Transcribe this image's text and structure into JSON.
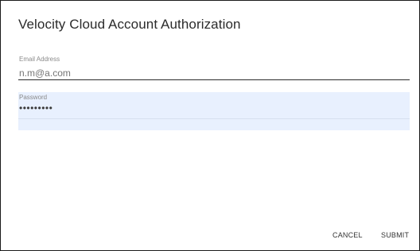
{
  "dialog": {
    "title": "Velocity Cloud Account Authorization"
  },
  "email": {
    "label": "Email Address",
    "value": "n.m@a.com"
  },
  "password": {
    "label": "Password",
    "value": "•••••••••"
  },
  "actions": {
    "cancel_label": "CANCEL",
    "submit_label": "SUBMIT"
  }
}
